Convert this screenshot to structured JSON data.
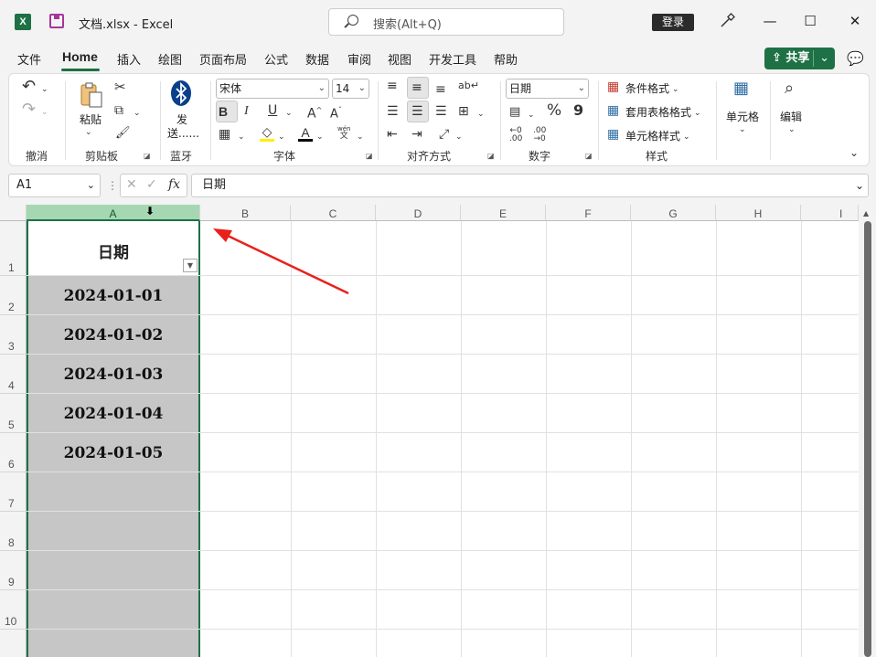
{
  "titlebar": {
    "app_icon": "X",
    "doc_title": "文档.xlsx  -  Excel",
    "search_placeholder": "搜索(Alt+Q)",
    "login": "登录",
    "minimize": "—",
    "maximize": "☐",
    "close": "✕"
  },
  "menu": {
    "items": [
      "文件",
      "Home",
      "插入",
      "绘图",
      "页面布局",
      "公式",
      "数据",
      "审阅",
      "视图",
      "开发工具",
      "帮助"
    ],
    "active": "Home",
    "share": "共享"
  },
  "ribbon": {
    "groups": {
      "undo": "撤消",
      "clipboard": "剪贴板",
      "bluetooth": "蓝牙",
      "font": "字体",
      "alignment": "对齐方式",
      "number": "数字",
      "styles": "样式"
    },
    "paste_label": "粘贴",
    "send_label_1": "发",
    "send_label_2": "送......",
    "font_name": "宋体",
    "font_size": "14",
    "bold": "B",
    "italic": "I",
    "underline": "U",
    "number_format": "日期",
    "conditional_format": "条件格式",
    "table_format": "套用表格格式",
    "cell_style": "单元格样式",
    "cells": "单元格",
    "editing": "编辑",
    "percent": "%",
    "comma": "9",
    "pinyin_top": "wén",
    "pinyin_bottom": "文"
  },
  "formula_bar": {
    "name_box": "A1",
    "fx": "fx",
    "content": "日期"
  },
  "sheet": {
    "columns": [
      "A",
      "B",
      "C",
      "D",
      "E",
      "F",
      "G",
      "H",
      "I"
    ],
    "rows": [
      "1",
      "2",
      "3",
      "4",
      "5",
      "6",
      "7",
      "8",
      "9",
      "10"
    ],
    "header": "日期",
    "dates": [
      "2024-01-01",
      "2024-01-02",
      "2024-01-03",
      "2024-01-04",
      "2024-01-05"
    ]
  },
  "colors": {
    "excel_green": "#1e7145",
    "selection_header": "#a6d7b3",
    "selected_cells": "#c6c6c6",
    "annotation_arrow": "#e8211c"
  }
}
